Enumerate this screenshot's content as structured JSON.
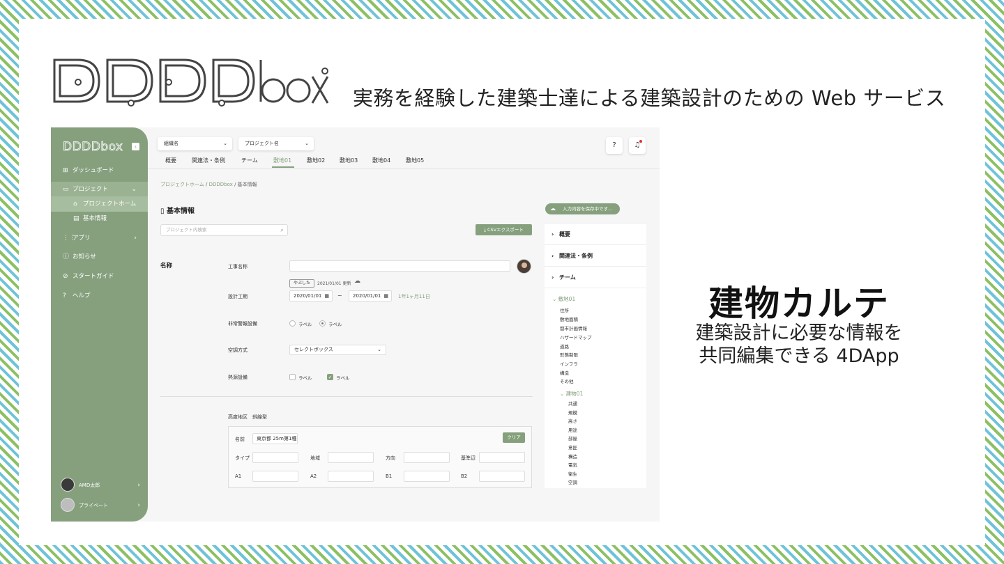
{
  "hero": {
    "logo_text": "DDDDbox",
    "tagline": "実務を経験した建築士達による建築設計のための Web サービス",
    "title": "建物カルテ",
    "subtitle_line1": "建築設計に必要な情報を",
    "subtitle_line2": "共同編集できる 4DApp"
  },
  "app": {
    "sidebar": {
      "logo": "DDDDbox",
      "collapse_icon": "chevron-left-icon",
      "items": [
        {
          "label": "ダッシュボード",
          "icon": "dashboard-icon"
        },
        {
          "label": "プロジェクト",
          "icon": "folder-icon"
        },
        {
          "label": "プロジェクトホーム",
          "icon": "home-icon"
        },
        {
          "label": "基本情報",
          "icon": "list-icon"
        },
        {
          "label": "アプリ",
          "icon": "grid-icon"
        },
        {
          "label": "お知らせ",
          "icon": "info-icon"
        },
        {
          "label": "スタートガイド",
          "icon": "compass-icon"
        },
        {
          "label": "ヘルプ",
          "icon": "help-icon"
        }
      ],
      "users": [
        {
          "name": "AMD太郎"
        },
        {
          "name": "プライベート"
        }
      ]
    },
    "topbar": {
      "org_select": "組織名",
      "project_select": "プロジェクト名",
      "tabs": [
        "概要",
        "関連法・条例",
        "チーム",
        "敷地01",
        "敷地02",
        "敷地03",
        "敷地04",
        "敷地05"
      ],
      "active_tab": "敷地01"
    },
    "breadcrumb": [
      "プロジェクトホーム",
      "DDDDbox",
      "基本情報"
    ],
    "page_title": "基本情報",
    "search_placeholder": "プロジェクト内検索",
    "csv_button": "CSVエクスポート",
    "save_status": "入力内容を保存中です...",
    "form": {
      "section": "名称",
      "fields": {
        "project_name_label": "工事名称",
        "project_name_value": "",
        "editor_chip": "やぶした",
        "updated_text": "2021/01/01 更新",
        "period_label": "設計工期",
        "date_from": "2020/01/01",
        "date_to": "2020/01/01",
        "duration": "1年1ヶ月11日",
        "alarm_label": "非常警報設備",
        "radio_a": "ラベル",
        "radio_b": "ラベル",
        "radio_selected": "b",
        "ac_label": "空調方式",
        "ac_select": "セレクトボックス",
        "heat_label": "熱源設備",
        "check_a": "ラベル",
        "check_b": "ラベル",
        "check_b_checked": true
      },
      "height": {
        "label": "高度地区　斜線型",
        "name_label": "名前",
        "name_value": "東京都 25m第1種",
        "clear_button": "クリア",
        "row1": [
          "タイプ",
          "地域",
          "方向",
          "基準辺"
        ],
        "row2": [
          "A1",
          "A2",
          "B1",
          "B2"
        ]
      }
    },
    "tree": {
      "headers": [
        "概要",
        "関連法・条例",
        "チーム"
      ],
      "site": "敷地01",
      "site_items": [
        "住所",
        "敷地面積",
        "都市計画情報",
        "ハザードマップ",
        "道路",
        "形態制限",
        "インフラ",
        "構造",
        "その他"
      ],
      "building": "建物01",
      "building_items": [
        "共通",
        "規模",
        "高さ",
        "用途",
        "部屋",
        "意匠",
        "構造",
        "電気",
        "衛生",
        "空調"
      ]
    }
  },
  "colors": {
    "accent": "#86a07e",
    "stripe_blue": "#6fc3d8",
    "stripe_green": "#8cc063"
  }
}
